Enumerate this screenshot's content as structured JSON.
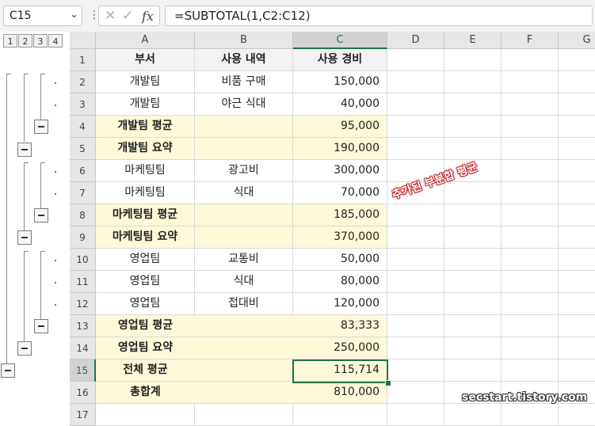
{
  "formula_bar": {
    "name_box": "C15",
    "formula": "=SUBTOTAL(1,C2:C12)",
    "fx_label": "fx"
  },
  "outline_levels": [
    "1",
    "2",
    "3",
    "4"
  ],
  "columns": [
    "A",
    "B",
    "C",
    "D",
    "E",
    "F",
    "G"
  ],
  "selected_column": "C",
  "selected_row": "15",
  "rows": [
    {
      "num": "1",
      "a": "부서",
      "b": "사용 내역",
      "c": "사용 경비",
      "style": "header"
    },
    {
      "num": "2",
      "a": "개발팀",
      "b": "비품 구매",
      "c": "150,000",
      "style": "data"
    },
    {
      "num": "3",
      "a": "개발팀",
      "b": "야근 식대",
      "c": "40,000",
      "style": "data"
    },
    {
      "num": "4",
      "a": "개발팀 평균",
      "b": "",
      "c": "95,000",
      "style": "sub"
    },
    {
      "num": "5",
      "a": "개발팀 요약",
      "b": "",
      "c": "190,000",
      "style": "sub"
    },
    {
      "num": "6",
      "a": "마케팅팀",
      "b": "광고비",
      "c": "300,000",
      "style": "data"
    },
    {
      "num": "7",
      "a": "마케팅팀",
      "b": "식대",
      "c": "70,000",
      "style": "data"
    },
    {
      "num": "8",
      "a": "마케팅팀 평균",
      "b": "",
      "c": "185,000",
      "style": "sub"
    },
    {
      "num": "9",
      "a": "마케팅팀 요약",
      "b": "",
      "c": "370,000",
      "style": "sub"
    },
    {
      "num": "10",
      "a": "영업팀",
      "b": "교통비",
      "c": "50,000",
      "style": "data"
    },
    {
      "num": "11",
      "a": "영업팀",
      "b": "식대",
      "c": "80,000",
      "style": "data"
    },
    {
      "num": "12",
      "a": "영업팀",
      "b": "접대비",
      "c": "120,000",
      "style": "data"
    },
    {
      "num": "13",
      "a": "영업팀 평균",
      "b": "",
      "c": "83,333",
      "style": "sub2"
    },
    {
      "num": "14",
      "a": "영업팀 요약",
      "b": "",
      "c": "250,000",
      "style": "sub2"
    },
    {
      "num": "15",
      "a": "전체 평균",
      "b": "",
      "c": "115,714",
      "style": "sub2"
    },
    {
      "num": "16",
      "a": "총합계",
      "b": "",
      "c": "810,000",
      "style": "sub2"
    },
    {
      "num": "17",
      "a": "",
      "b": "",
      "c": "",
      "style": "empty"
    }
  ],
  "annotation": "추가된 부분합 평균",
  "watermark": "secstart.tistory.com",
  "colors": {
    "accent": "#217346",
    "subtotal_fill": "#fdf9d9",
    "header_fill": "#f2f2f2",
    "annotation": "#c0282a"
  }
}
